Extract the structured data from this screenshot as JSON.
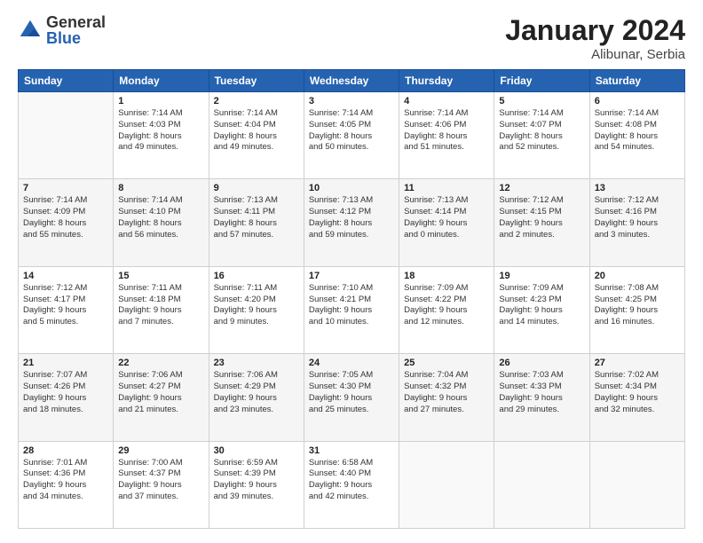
{
  "header": {
    "logo": {
      "general": "General",
      "blue": "Blue"
    },
    "title": "January 2024",
    "location": "Alibunar, Serbia"
  },
  "calendar": {
    "days_of_week": [
      "Sunday",
      "Monday",
      "Tuesday",
      "Wednesday",
      "Thursday",
      "Friday",
      "Saturday"
    ],
    "weeks": [
      [
        {
          "day": "",
          "info": ""
        },
        {
          "day": "1",
          "info": "Sunrise: 7:14 AM\nSunset: 4:03 PM\nDaylight: 8 hours\nand 49 minutes."
        },
        {
          "day": "2",
          "info": "Sunrise: 7:14 AM\nSunset: 4:04 PM\nDaylight: 8 hours\nand 49 minutes."
        },
        {
          "day": "3",
          "info": "Sunrise: 7:14 AM\nSunset: 4:05 PM\nDaylight: 8 hours\nand 50 minutes."
        },
        {
          "day": "4",
          "info": "Sunrise: 7:14 AM\nSunset: 4:06 PM\nDaylight: 8 hours\nand 51 minutes."
        },
        {
          "day": "5",
          "info": "Sunrise: 7:14 AM\nSunset: 4:07 PM\nDaylight: 8 hours\nand 52 minutes."
        },
        {
          "day": "6",
          "info": "Sunrise: 7:14 AM\nSunset: 4:08 PM\nDaylight: 8 hours\nand 54 minutes."
        }
      ],
      [
        {
          "day": "7",
          "info": "Sunrise: 7:14 AM\nSunset: 4:09 PM\nDaylight: 8 hours\nand 55 minutes."
        },
        {
          "day": "8",
          "info": "Sunrise: 7:14 AM\nSunset: 4:10 PM\nDaylight: 8 hours\nand 56 minutes."
        },
        {
          "day": "9",
          "info": "Sunrise: 7:13 AM\nSunset: 4:11 PM\nDaylight: 8 hours\nand 57 minutes."
        },
        {
          "day": "10",
          "info": "Sunrise: 7:13 AM\nSunset: 4:12 PM\nDaylight: 8 hours\nand 59 minutes."
        },
        {
          "day": "11",
          "info": "Sunrise: 7:13 AM\nSunset: 4:14 PM\nDaylight: 9 hours\nand 0 minutes."
        },
        {
          "day": "12",
          "info": "Sunrise: 7:12 AM\nSunset: 4:15 PM\nDaylight: 9 hours\nand 2 minutes."
        },
        {
          "day": "13",
          "info": "Sunrise: 7:12 AM\nSunset: 4:16 PM\nDaylight: 9 hours\nand 3 minutes."
        }
      ],
      [
        {
          "day": "14",
          "info": "Sunrise: 7:12 AM\nSunset: 4:17 PM\nDaylight: 9 hours\nand 5 minutes."
        },
        {
          "day": "15",
          "info": "Sunrise: 7:11 AM\nSunset: 4:18 PM\nDaylight: 9 hours\nand 7 minutes."
        },
        {
          "day": "16",
          "info": "Sunrise: 7:11 AM\nSunset: 4:20 PM\nDaylight: 9 hours\nand 9 minutes."
        },
        {
          "day": "17",
          "info": "Sunrise: 7:10 AM\nSunset: 4:21 PM\nDaylight: 9 hours\nand 10 minutes."
        },
        {
          "day": "18",
          "info": "Sunrise: 7:09 AM\nSunset: 4:22 PM\nDaylight: 9 hours\nand 12 minutes."
        },
        {
          "day": "19",
          "info": "Sunrise: 7:09 AM\nSunset: 4:23 PM\nDaylight: 9 hours\nand 14 minutes."
        },
        {
          "day": "20",
          "info": "Sunrise: 7:08 AM\nSunset: 4:25 PM\nDaylight: 9 hours\nand 16 minutes."
        }
      ],
      [
        {
          "day": "21",
          "info": "Sunrise: 7:07 AM\nSunset: 4:26 PM\nDaylight: 9 hours\nand 18 minutes."
        },
        {
          "day": "22",
          "info": "Sunrise: 7:06 AM\nSunset: 4:27 PM\nDaylight: 9 hours\nand 21 minutes."
        },
        {
          "day": "23",
          "info": "Sunrise: 7:06 AM\nSunset: 4:29 PM\nDaylight: 9 hours\nand 23 minutes."
        },
        {
          "day": "24",
          "info": "Sunrise: 7:05 AM\nSunset: 4:30 PM\nDaylight: 9 hours\nand 25 minutes."
        },
        {
          "day": "25",
          "info": "Sunrise: 7:04 AM\nSunset: 4:32 PM\nDaylight: 9 hours\nand 27 minutes."
        },
        {
          "day": "26",
          "info": "Sunrise: 7:03 AM\nSunset: 4:33 PM\nDaylight: 9 hours\nand 29 minutes."
        },
        {
          "day": "27",
          "info": "Sunrise: 7:02 AM\nSunset: 4:34 PM\nDaylight: 9 hours\nand 32 minutes."
        }
      ],
      [
        {
          "day": "28",
          "info": "Sunrise: 7:01 AM\nSunset: 4:36 PM\nDaylight: 9 hours\nand 34 minutes."
        },
        {
          "day": "29",
          "info": "Sunrise: 7:00 AM\nSunset: 4:37 PM\nDaylight: 9 hours\nand 37 minutes."
        },
        {
          "day": "30",
          "info": "Sunrise: 6:59 AM\nSunset: 4:39 PM\nDaylight: 9 hours\nand 39 minutes."
        },
        {
          "day": "31",
          "info": "Sunrise: 6:58 AM\nSunset: 4:40 PM\nDaylight: 9 hours\nand 42 minutes."
        },
        {
          "day": "",
          "info": ""
        },
        {
          "day": "",
          "info": ""
        },
        {
          "day": "",
          "info": ""
        }
      ]
    ]
  }
}
